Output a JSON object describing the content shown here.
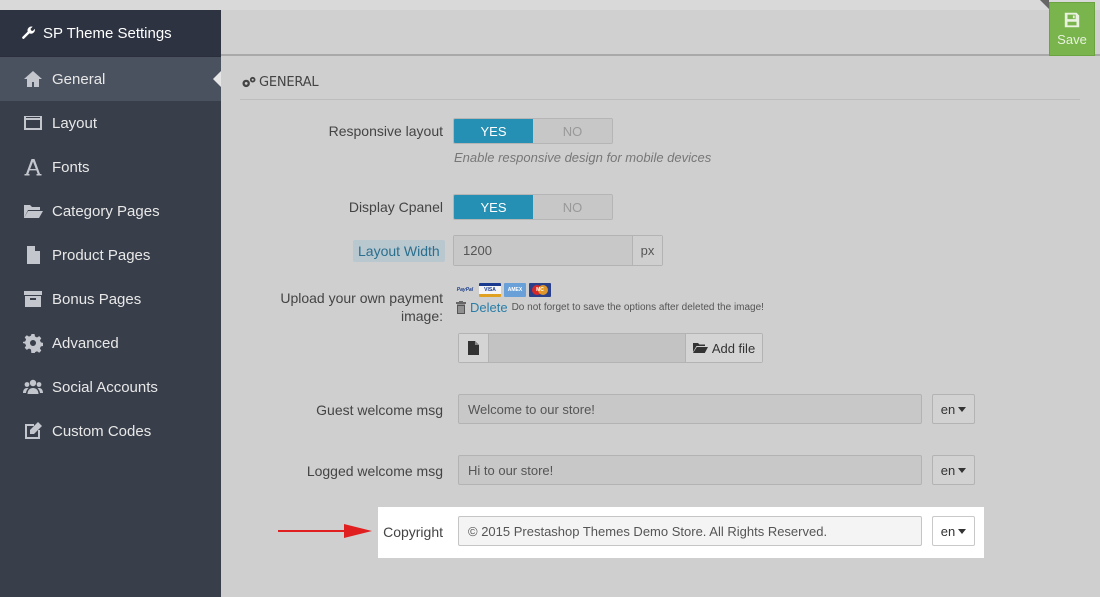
{
  "app": {
    "title": "SP Theme Settings"
  },
  "toolbar": {
    "save_label": "Save"
  },
  "sidebar": {
    "items": [
      {
        "label": "General",
        "icon": "home-icon",
        "active": true
      },
      {
        "label": "Layout",
        "icon": "layout-icon"
      },
      {
        "label": "Fonts",
        "icon": "font-icon"
      },
      {
        "label": "Category Pages",
        "icon": "folder-open-icon"
      },
      {
        "label": "Product Pages",
        "icon": "file-icon"
      },
      {
        "label": "Bonus Pages",
        "icon": "archive-icon"
      },
      {
        "label": "Advanced",
        "icon": "gear-icon"
      },
      {
        "label": "Social Accounts",
        "icon": "users-icon"
      },
      {
        "label": "Custom Codes",
        "icon": "edit-icon"
      }
    ]
  },
  "section": {
    "title": "GENERAL"
  },
  "form": {
    "responsive": {
      "label": "Responsive layout",
      "yes": "YES",
      "no": "NO",
      "value": "YES",
      "help": "Enable responsive design for mobile devices"
    },
    "cpanel": {
      "label": "Display Cpanel",
      "yes": "YES",
      "no": "NO",
      "value": "YES"
    },
    "layout_width": {
      "label": "Layout Width",
      "value": "1200",
      "unit": "px"
    },
    "payment": {
      "label_line1": "Upload your own payment",
      "label_line2": "image:",
      "delete_label": "Delete",
      "note": "Do not forget to save the options after deleted the image!",
      "add_file": "Add file",
      "cards": [
        "PayPal",
        "VISA",
        "AMEX",
        "MC"
      ]
    },
    "guest": {
      "label": "Guest welcome msg",
      "value": "Welcome to our store!",
      "lang": "en"
    },
    "logged": {
      "label": "Logged welcome msg",
      "value": "Hi to our store!",
      "lang": "en"
    },
    "copyright": {
      "label": "Copyright",
      "value": "© 2015 Prestashop Themes Demo Store. All Rights Reserved.",
      "lang": "en"
    }
  },
  "colors": {
    "sidebar": "#383e4a",
    "toggle_active": "#2590b3",
    "save": "#79b44c",
    "arrow": "#e02020"
  }
}
